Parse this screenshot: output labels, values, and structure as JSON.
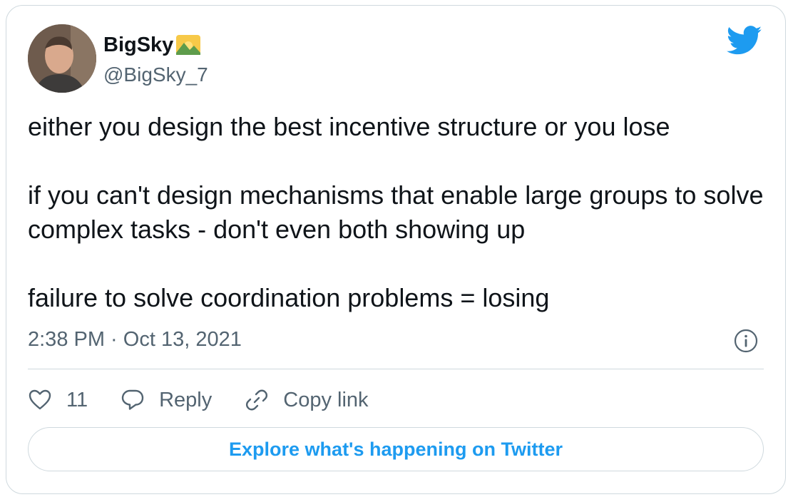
{
  "author": {
    "name": "BigSky",
    "name_emoji": "sunrise-over-mountains-emoji",
    "handle": "@BigSky_7"
  },
  "tweet": {
    "paragraphs": [
      "either you design the best incentive structure or you lose",
      "if you can't design mechanisms that enable large groups to solve complex tasks - don't even both showing up",
      "failure to solve coordination problems = losing"
    ],
    "timestamp": "2:38 PM · Oct 13, 2021"
  },
  "actions": {
    "like_count": "11",
    "reply_label": "Reply",
    "copy_link_label": "Copy link"
  },
  "explore_label": "Explore what's happening on Twitter",
  "colors": {
    "accent": "#1d9bf0",
    "secondary_text": "#536471",
    "border": "#cfd9de"
  },
  "icons": [
    "twitter-bird-icon",
    "info-icon",
    "heart-icon",
    "reply-icon",
    "link-icon"
  ]
}
